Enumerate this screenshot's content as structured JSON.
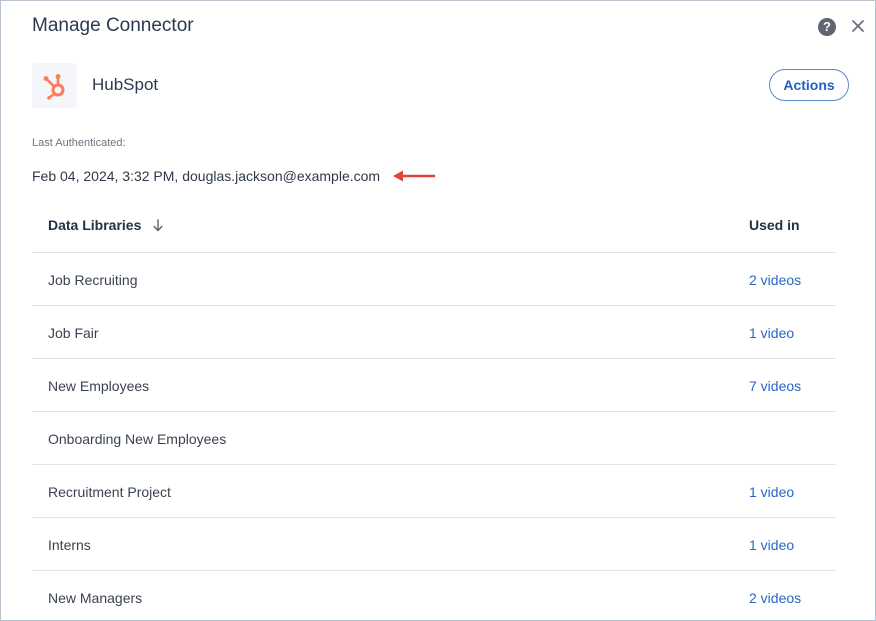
{
  "dialog": {
    "title": "Manage Connector",
    "help_icon": "help-circle-icon",
    "help_glyph": "?",
    "close_icon": "close-icon"
  },
  "connector": {
    "name": "HubSpot",
    "logo_icon": "hubspot-logo-icon",
    "brand_color": "#ff7a59",
    "actions_label": "Actions"
  },
  "auth": {
    "label": "Last Authenticated:",
    "value": "Feb 04, 2024, 3:32 PM, douglas.jackson@example.com",
    "annotation": "red-arrow-icon",
    "annotation_color": "#e0443c"
  },
  "table": {
    "columns": {
      "name": "Data Libraries",
      "used": "Used in",
      "sort_icon": "arrow-down-icon"
    },
    "rows": [
      {
        "name": "Job Recruiting",
        "used": "2 videos"
      },
      {
        "name": "Job Fair",
        "used": "1 video"
      },
      {
        "name": "New Employees",
        "used": "7 videos"
      },
      {
        "name": "Onboarding New Employees",
        "used": ""
      },
      {
        "name": "Recruitment Project",
        "used": "1 video"
      },
      {
        "name": "Interns",
        "used": "1 video"
      },
      {
        "name": "New Managers",
        "used": "2 videos"
      }
    ]
  }
}
